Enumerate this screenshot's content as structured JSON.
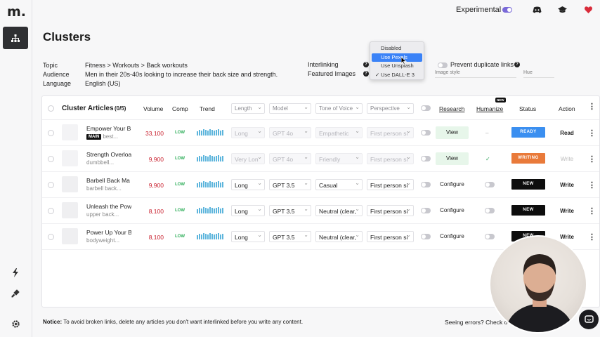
{
  "app": {
    "logo": "m.",
    "experimental_label": "Experimental"
  },
  "page": {
    "title": "Clusters"
  },
  "meta": {
    "topic_label": "Topic",
    "topic_value": "Fitness > Workouts > Back workouts",
    "audience_label": "Audience",
    "audience_value": "Men in their 20s-40s looking to increase their back size and strength.",
    "language_label": "Language",
    "language_value": "English (US)",
    "interlinking_label": "Interlinking",
    "featured_images_label": "Featured Images",
    "prevent_duplicate_label": "Prevent duplicate links",
    "image_style_placeholder": "Image style",
    "hue_placeholder": "Hue"
  },
  "featured_images_menu": {
    "options": [
      "Disabled",
      "Use Pexels",
      "Use Unsplash",
      "Use DALL-E 3"
    ],
    "highlighted": "Use Pexels",
    "checked": "Use DALL-E 3",
    "check_mark": "✓"
  },
  "table": {
    "header": {
      "cluster_articles": "Cluster Articles",
      "count": "(0/5)",
      "volume": "Volume",
      "comp": "Comp",
      "trend": "Trend",
      "length": "Length",
      "model": "Model",
      "tone": "Tone of Voice",
      "perspective": "Perspective",
      "research": "Research",
      "humanize": "Humanize",
      "new_tag": "NEW",
      "status": "Status",
      "action": "Action"
    },
    "rows": [
      {
        "title": "Empower Your B",
        "main_badge": "MAIN",
        "subtitle": "best...",
        "volume": "33,100",
        "comp": "LOW",
        "length": "Long",
        "model": "GPT 4o",
        "tone": "Empathetic",
        "perspective": "First person si",
        "research": "View",
        "humanize": "–",
        "status": "READY",
        "action": "Read"
      },
      {
        "title": "Strength Overloa",
        "main_badge": "",
        "subtitle": "dumbbell...",
        "volume": "9,900",
        "comp": "LOW",
        "length": "Very Lon",
        "model": "GPT 4o",
        "tone": "Friendly",
        "perspective": "First person si",
        "research": "View",
        "humanize": "✓",
        "status": "WRITING",
        "action": "Write"
      },
      {
        "title": "Barbell Back Ma",
        "main_badge": "",
        "subtitle": "barbell back...",
        "volume": "9,900",
        "comp": "LOW",
        "length": "Long",
        "model": "GPT 3.5",
        "tone": "Casual",
        "perspective": "First person si",
        "research": "Configure",
        "humanize": "",
        "status": "NEW",
        "action": "Write"
      },
      {
        "title": "Unleash the Pow",
        "main_badge": "",
        "subtitle": "upper back...",
        "volume": "8,100",
        "comp": "LOW",
        "length": "Long",
        "model": "GPT 3.5",
        "tone": "Neutral (clear,",
        "perspective": "First person si",
        "research": "Configure",
        "humanize": "",
        "status": "NEW",
        "action": "Write"
      },
      {
        "title": "Power Up Your B",
        "main_badge": "",
        "subtitle": "bodyweight...",
        "volume": "8,100",
        "comp": "LOW",
        "length": "Long",
        "model": "GPT 3.5",
        "tone": "Neutral (clear,",
        "perspective": "First person si",
        "research": "Configure",
        "humanize": "",
        "status": "NEW",
        "action": "Write"
      }
    ]
  },
  "footer": {
    "notice_label": "Notice:",
    "notice_text": "To avoid broken links, delete any articles you don't want interlinked before you write any content.",
    "seeing_errors": "Seeing errors? Check o"
  },
  "colors": {
    "ready": "#3b8ff0",
    "writing": "#e97a3a",
    "new": "#0d0d0d",
    "volume_red": "#c81e2c",
    "low_green": "#2fae5a",
    "accent": "#7a6ad8"
  }
}
